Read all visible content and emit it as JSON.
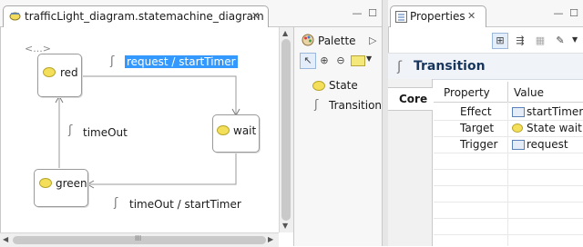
{
  "editor": {
    "tab_title": "trafficLight_diagram.statemachine_diagram",
    "close_glyph": "✕",
    "minimize_glyph": "—",
    "maximize_glyph": "☐",
    "ellipsis_label": "<...>",
    "states": {
      "red": "red",
      "wait": "wait",
      "green": "green"
    },
    "transitions": {
      "red_to_wait": "request / startTimer",
      "wait_to_green": "timeOut / startTimer",
      "green_to_red": "timeOut"
    },
    "scroll_h_thumb_glyph": "III"
  },
  "palette": {
    "title": "Palette",
    "expand_glyph": "▷",
    "items": [
      "State",
      "Transition"
    ]
  },
  "properties": {
    "tab_title": "Properties",
    "close_glyph": "✕",
    "header_title": "Transition",
    "side_tab": "Core",
    "columns": [
      "Property",
      "Value"
    ],
    "rows": [
      {
        "property": "Effect",
        "value": "startTimer",
        "icon": "operation-icon"
      },
      {
        "property": "Target",
        "value": "State wait",
        "icon": "state-icon"
      },
      {
        "property": "Trigger",
        "value": "request",
        "icon": "operation-icon"
      }
    ]
  },
  "colors": {
    "selection": "#3399ff",
    "state_fill": "#f3df5a"
  }
}
